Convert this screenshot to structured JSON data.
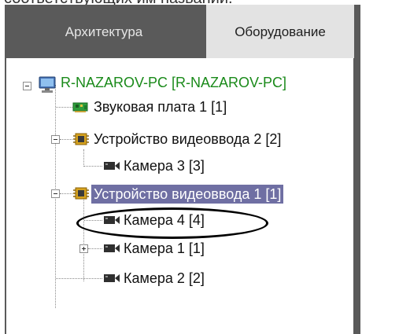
{
  "page": {
    "caption": "соответствующих им названий."
  },
  "tabs": [
    {
      "label": "Архитектура",
      "active": false
    },
    {
      "label": "Оборудование",
      "active": true
    }
  ],
  "tree": {
    "root": {
      "label": "R-NAZAROV-PC [R-NAZAROV-PC]",
      "icon": "computer-icon",
      "expanded": true
    },
    "nodes": [
      {
        "label": "Звуковая плата 1 [1]",
        "icon": "sound-card-icon"
      },
      {
        "label": "Устройство видеоввода 2 [2]",
        "icon": "chip-icon",
        "expanded": true
      },
      {
        "label": "Камера 3 [3]",
        "icon": "camera-icon"
      },
      {
        "label": "Устройство видеоввода 1 [1]",
        "icon": "chip-icon",
        "expanded": true,
        "selected": true
      },
      {
        "label": "Камера 4 [4]",
        "icon": "camera-icon",
        "circled": true
      },
      {
        "label": "Камера 1 [1]",
        "icon": "camera-icon",
        "expanded": false
      },
      {
        "label": "Камера 2 [2]",
        "icon": "camera-icon"
      }
    ]
  },
  "colors": {
    "root_text": "#1a8a1a",
    "selection": "#6f6fa3",
    "tab_bar": "#5a5a5a",
    "active_tab": "#e3e3e3"
  }
}
